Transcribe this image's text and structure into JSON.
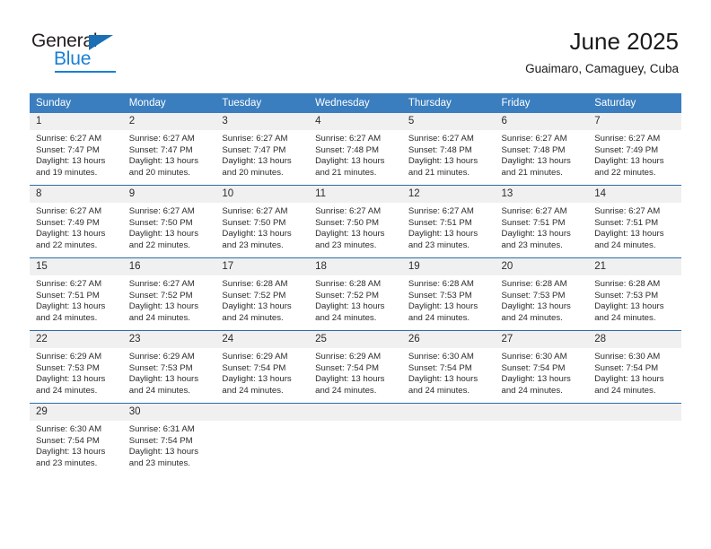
{
  "brand": {
    "name_part1": "General",
    "name_part2": "Blue",
    "accent_color": "#1a7fd4",
    "triangle_color": "#1a6fb5"
  },
  "header": {
    "title": "June 2025",
    "subtitle": "Guaimaro, Camaguey, Cuba"
  },
  "theme": {
    "header_row_bg": "#3a7ebf",
    "header_row_text": "#ffffff",
    "daynum_bg": "#f0f0f0",
    "row_divider": "#2c6ca8",
    "cell_bg": "#ffffff"
  },
  "weekdays": [
    "Sunday",
    "Monday",
    "Tuesday",
    "Wednesday",
    "Thursday",
    "Friday",
    "Saturday"
  ],
  "labels": {
    "sunrise_prefix": "Sunrise: ",
    "sunset_prefix": "Sunset: ",
    "daylight_prefix": "Daylight: "
  },
  "weeks": [
    [
      {
        "day": "1",
        "sunrise": "Sunrise: 6:27 AM",
        "sunset": "Sunset: 7:47 PM",
        "daylight": "Daylight: 13 hours and 19 minutes."
      },
      {
        "day": "2",
        "sunrise": "Sunrise: 6:27 AM",
        "sunset": "Sunset: 7:47 PM",
        "daylight": "Daylight: 13 hours and 20 minutes."
      },
      {
        "day": "3",
        "sunrise": "Sunrise: 6:27 AM",
        "sunset": "Sunset: 7:47 PM",
        "daylight": "Daylight: 13 hours and 20 minutes."
      },
      {
        "day": "4",
        "sunrise": "Sunrise: 6:27 AM",
        "sunset": "Sunset: 7:48 PM",
        "daylight": "Daylight: 13 hours and 21 minutes."
      },
      {
        "day": "5",
        "sunrise": "Sunrise: 6:27 AM",
        "sunset": "Sunset: 7:48 PM",
        "daylight": "Daylight: 13 hours and 21 minutes."
      },
      {
        "day": "6",
        "sunrise": "Sunrise: 6:27 AM",
        "sunset": "Sunset: 7:48 PM",
        "daylight": "Daylight: 13 hours and 21 minutes."
      },
      {
        "day": "7",
        "sunrise": "Sunrise: 6:27 AM",
        "sunset": "Sunset: 7:49 PM",
        "daylight": "Daylight: 13 hours and 22 minutes."
      }
    ],
    [
      {
        "day": "8",
        "sunrise": "Sunrise: 6:27 AM",
        "sunset": "Sunset: 7:49 PM",
        "daylight": "Daylight: 13 hours and 22 minutes."
      },
      {
        "day": "9",
        "sunrise": "Sunrise: 6:27 AM",
        "sunset": "Sunset: 7:50 PM",
        "daylight": "Daylight: 13 hours and 22 minutes."
      },
      {
        "day": "10",
        "sunrise": "Sunrise: 6:27 AM",
        "sunset": "Sunset: 7:50 PM",
        "daylight": "Daylight: 13 hours and 23 minutes."
      },
      {
        "day": "11",
        "sunrise": "Sunrise: 6:27 AM",
        "sunset": "Sunset: 7:50 PM",
        "daylight": "Daylight: 13 hours and 23 minutes."
      },
      {
        "day": "12",
        "sunrise": "Sunrise: 6:27 AM",
        "sunset": "Sunset: 7:51 PM",
        "daylight": "Daylight: 13 hours and 23 minutes."
      },
      {
        "day": "13",
        "sunrise": "Sunrise: 6:27 AM",
        "sunset": "Sunset: 7:51 PM",
        "daylight": "Daylight: 13 hours and 23 minutes."
      },
      {
        "day": "14",
        "sunrise": "Sunrise: 6:27 AM",
        "sunset": "Sunset: 7:51 PM",
        "daylight": "Daylight: 13 hours and 24 minutes."
      }
    ],
    [
      {
        "day": "15",
        "sunrise": "Sunrise: 6:27 AM",
        "sunset": "Sunset: 7:51 PM",
        "daylight": "Daylight: 13 hours and 24 minutes."
      },
      {
        "day": "16",
        "sunrise": "Sunrise: 6:27 AM",
        "sunset": "Sunset: 7:52 PM",
        "daylight": "Daylight: 13 hours and 24 minutes."
      },
      {
        "day": "17",
        "sunrise": "Sunrise: 6:28 AM",
        "sunset": "Sunset: 7:52 PM",
        "daylight": "Daylight: 13 hours and 24 minutes."
      },
      {
        "day": "18",
        "sunrise": "Sunrise: 6:28 AM",
        "sunset": "Sunset: 7:52 PM",
        "daylight": "Daylight: 13 hours and 24 minutes."
      },
      {
        "day": "19",
        "sunrise": "Sunrise: 6:28 AM",
        "sunset": "Sunset: 7:53 PM",
        "daylight": "Daylight: 13 hours and 24 minutes."
      },
      {
        "day": "20",
        "sunrise": "Sunrise: 6:28 AM",
        "sunset": "Sunset: 7:53 PM",
        "daylight": "Daylight: 13 hours and 24 minutes."
      },
      {
        "day": "21",
        "sunrise": "Sunrise: 6:28 AM",
        "sunset": "Sunset: 7:53 PM",
        "daylight": "Daylight: 13 hours and 24 minutes."
      }
    ],
    [
      {
        "day": "22",
        "sunrise": "Sunrise: 6:29 AM",
        "sunset": "Sunset: 7:53 PM",
        "daylight": "Daylight: 13 hours and 24 minutes."
      },
      {
        "day": "23",
        "sunrise": "Sunrise: 6:29 AM",
        "sunset": "Sunset: 7:53 PM",
        "daylight": "Daylight: 13 hours and 24 minutes."
      },
      {
        "day": "24",
        "sunrise": "Sunrise: 6:29 AM",
        "sunset": "Sunset: 7:54 PM",
        "daylight": "Daylight: 13 hours and 24 minutes."
      },
      {
        "day": "25",
        "sunrise": "Sunrise: 6:29 AM",
        "sunset": "Sunset: 7:54 PM",
        "daylight": "Daylight: 13 hours and 24 minutes."
      },
      {
        "day": "26",
        "sunrise": "Sunrise: 6:30 AM",
        "sunset": "Sunset: 7:54 PM",
        "daylight": "Daylight: 13 hours and 24 minutes."
      },
      {
        "day": "27",
        "sunrise": "Sunrise: 6:30 AM",
        "sunset": "Sunset: 7:54 PM",
        "daylight": "Daylight: 13 hours and 24 minutes."
      },
      {
        "day": "28",
        "sunrise": "Sunrise: 6:30 AM",
        "sunset": "Sunset: 7:54 PM",
        "daylight": "Daylight: 13 hours and 24 minutes."
      }
    ],
    [
      {
        "day": "29",
        "sunrise": "Sunrise: 6:30 AM",
        "sunset": "Sunset: 7:54 PM",
        "daylight": "Daylight: 13 hours and 23 minutes."
      },
      {
        "day": "30",
        "sunrise": "Sunrise: 6:31 AM",
        "sunset": "Sunset: 7:54 PM",
        "daylight": "Daylight: 13 hours and 23 minutes."
      },
      {
        "day": "",
        "sunrise": "",
        "sunset": "",
        "daylight": ""
      },
      {
        "day": "",
        "sunrise": "",
        "sunset": "",
        "daylight": ""
      },
      {
        "day": "",
        "sunrise": "",
        "sunset": "",
        "daylight": ""
      },
      {
        "day": "",
        "sunrise": "",
        "sunset": "",
        "daylight": ""
      },
      {
        "day": "",
        "sunrise": "",
        "sunset": "",
        "daylight": ""
      }
    ]
  ]
}
